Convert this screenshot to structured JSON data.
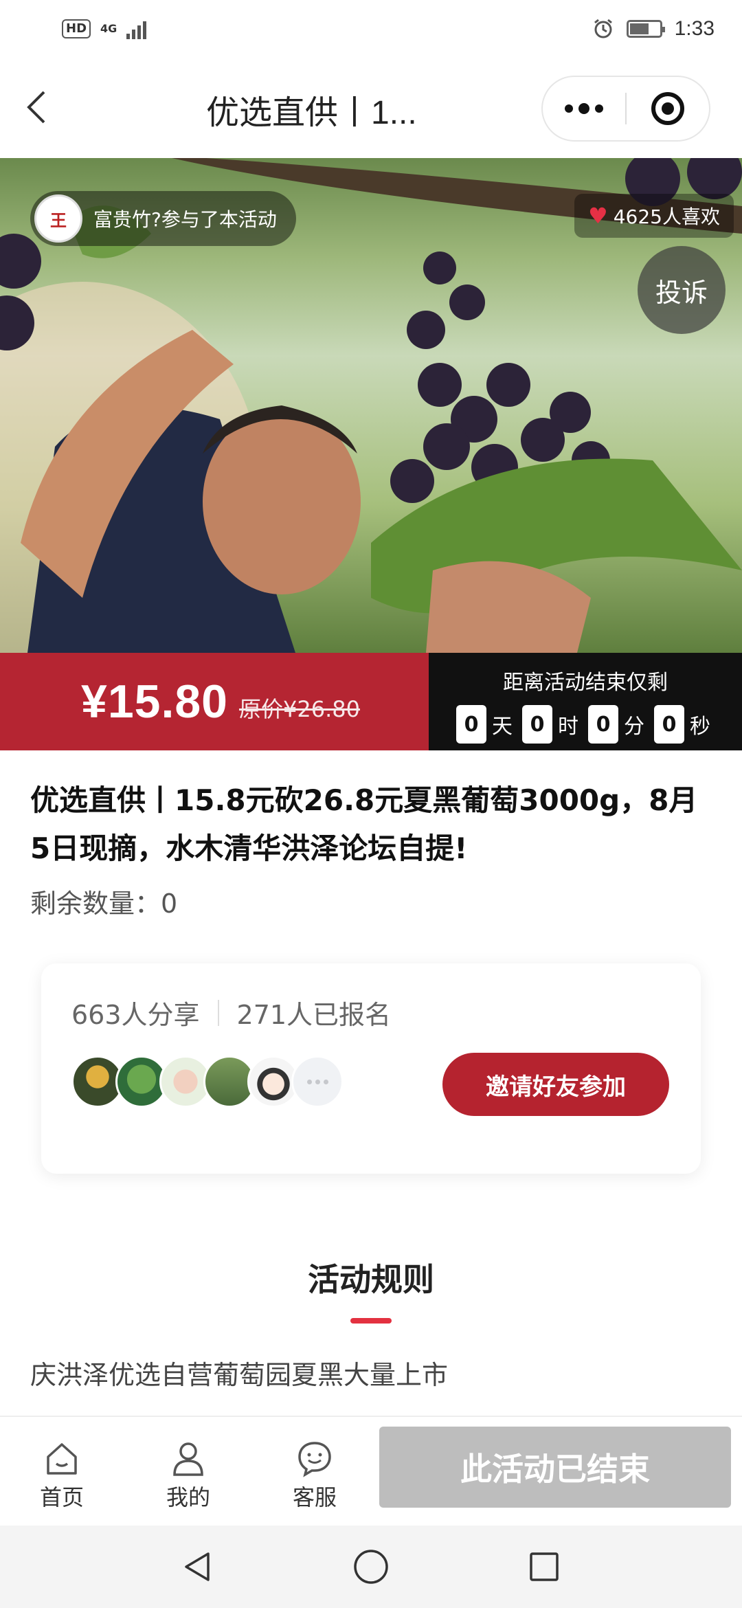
{
  "status_bar": {
    "network": "4G",
    "hd": "HD",
    "time": "1:33"
  },
  "nav": {
    "title": "优选直供丨1..."
  },
  "hero": {
    "participant_text": "富贵竹?参与了本活动",
    "participant_avatar_text": "王",
    "likes_text": "4625人喜欢",
    "complain_label": "投诉"
  },
  "price": {
    "current": "¥15.80",
    "original": "原价¥26.80"
  },
  "countdown": {
    "title": "距离活动结束仅剩",
    "days": "0",
    "days_unit": "天",
    "hours": "0",
    "hours_unit": "时",
    "minutes": "0",
    "minutes_unit": "分",
    "seconds": "0",
    "seconds_unit": "秒"
  },
  "product": {
    "title": "优选直供丨15.8元砍26.8元夏黑葡萄3000g，8月5日现摘，水木清华洪泽论坛自提!",
    "remaining": "剩余数量：0"
  },
  "share_card": {
    "shares": "663人分享",
    "registered": "271人已报名",
    "invite_label": "邀请好友参加"
  },
  "rules": {
    "heading": "活动规则",
    "text": "庆洪泽优选自营葡萄园夏黑大量上市"
  },
  "tabbar": {
    "home": "首页",
    "mine": "我的",
    "service": "客服",
    "ended_label": "此活动已结束"
  },
  "colors": {
    "accent": "#b52532",
    "countdown_bg": "#111111",
    "disabled": "#bdbdbd"
  }
}
